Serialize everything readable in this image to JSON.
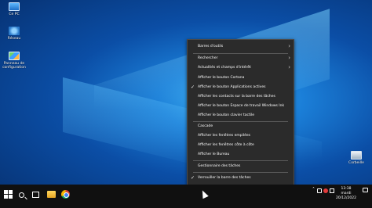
{
  "desktop": {
    "icons": [
      {
        "label": "Ce PC",
        "icon": "computer-icon"
      },
      {
        "label": "Réseau",
        "icon": "network-icon"
      },
      {
        "label": "Panneau de configuration",
        "icon": "control-panel-icon"
      },
      {
        "label": "Corbeille",
        "icon": "recycle-bin-icon"
      }
    ]
  },
  "context_menu": {
    "items": [
      {
        "label": "Barres d'outils",
        "submenu": true
      },
      {
        "label": "Rechercher",
        "submenu": true
      },
      {
        "label": "Actualités et champs d'intérêt",
        "submenu": true
      },
      {
        "label": "Afficher le bouton Cortana"
      },
      {
        "label": "Afficher le bouton Applications actives",
        "checked": true
      },
      {
        "label": "Afficher les contacts sur la barre des tâches"
      },
      {
        "label": "Afficher le bouton Espace de travail Windows Ink"
      },
      {
        "label": "Afficher le bouton clavier tactile"
      },
      {
        "label": "Cascade"
      },
      {
        "label": "Afficher les fenêtres empilées"
      },
      {
        "label": "Afficher les fenêtres côte à côte"
      },
      {
        "label": "Afficher le Bureau"
      },
      {
        "label": "Gestionnaire des tâches"
      },
      {
        "label": "Verrouiller la barre des tâches",
        "checked": true
      },
      {
        "label": "Paramètres de la barre des tâches",
        "icon": "gear-icon"
      }
    ]
  },
  "taskbar": {
    "pinned": [
      "start-icon",
      "search-icon",
      "task-view-icon",
      "file-explorer-icon",
      "chrome-icon"
    ],
    "tray": [
      "chevron-up-icon",
      "network-icon",
      "volume-muted-icon",
      "battery-icon"
    ],
    "clock": {
      "time": "13:38",
      "day": "mardi",
      "date": "20/12/2022"
    }
  },
  "colors": {
    "menu_bg": "#2b2b2b",
    "taskbar_bg": "#101010",
    "desktop_blue": "#1b7fd8"
  }
}
